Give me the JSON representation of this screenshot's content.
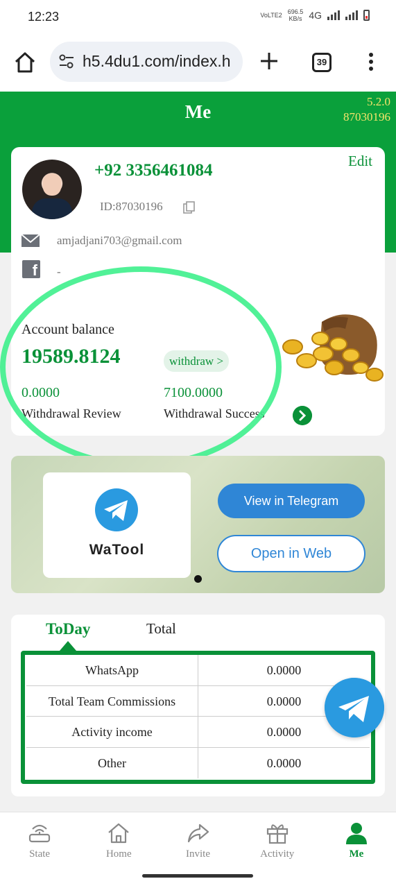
{
  "status_bar": {
    "time": "12:23",
    "net_label": "VoLTE2",
    "speed_value": "696.5",
    "speed_unit": "KB/s",
    "network": "4G"
  },
  "browser": {
    "url": "h5.4du1.com/index.h",
    "tab_count": "39"
  },
  "header": {
    "title": "Me",
    "version": "5.2.0",
    "user_code": "87030196"
  },
  "profile": {
    "phone": "+92 3356461084",
    "edit_label": "Edit",
    "id_text": "ID:87030196",
    "email": "amjadjani703@gmail.com",
    "facebook": "-"
  },
  "balance": {
    "label": "Account balance",
    "value": "19589.8124",
    "withdraw_label": "withdraw >",
    "review_value": "0.0000",
    "review_label": "Withdrawal Review",
    "success_value": "7100.0000",
    "success_label": "Withdrawal Success"
  },
  "banner": {
    "app_name": "WaTool",
    "view_telegram_label": "View in Telegram",
    "open_web_label": "Open in Web"
  },
  "stats": {
    "tabs": [
      "ToDay",
      "Total"
    ],
    "active_tab": "ToDay",
    "rows": [
      {
        "name": "WhatsApp",
        "value": "0.0000"
      },
      {
        "name": "Total Team Commissions",
        "value": "0.0000"
      },
      {
        "name": "Activity income",
        "value": "0.0000"
      },
      {
        "name": "Other",
        "value": "0.0000"
      }
    ]
  },
  "nav": {
    "items": [
      {
        "label": "State",
        "icon": "router-icon"
      },
      {
        "label": "Home",
        "icon": "home-icon"
      },
      {
        "label": "Invite",
        "icon": "share-icon"
      },
      {
        "label": "Activity",
        "icon": "gift-icon"
      },
      {
        "label": "Me",
        "icon": "person-icon"
      }
    ],
    "active": "Me"
  },
  "colors": {
    "brand_green": "#0aa03b",
    "text_green": "#0a9138",
    "version_yellow": "#f5e46a",
    "telegram_blue": "#2f86d6",
    "highlight_ring": "#3ef08c"
  }
}
